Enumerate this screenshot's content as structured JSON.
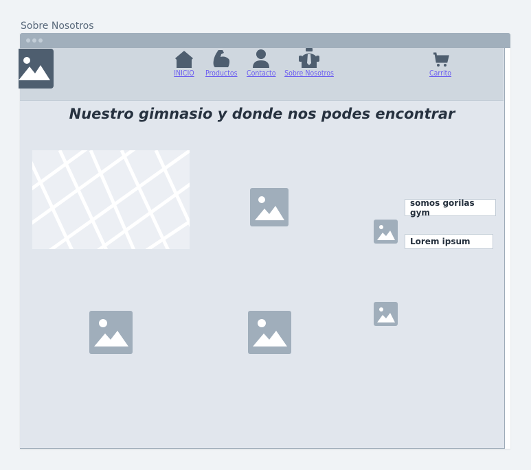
{
  "page": {
    "title": "Sobre Nosotros"
  },
  "nav": {
    "items": [
      {
        "label": "INICIO",
        "icon": "home-icon"
      },
      {
        "label": "Productos",
        "icon": "flexed-arm-icon"
      },
      {
        "label": "Contacto",
        "icon": "user-icon"
      },
      {
        "label": "Sobre Nosotros",
        "icon": "user-tie-icon"
      }
    ],
    "cart": {
      "label": "Carrito",
      "icon": "shopping-cart-icon"
    }
  },
  "main": {
    "headline": "Nuestro gimnasio y donde nos podes encontrar",
    "info": {
      "name_value": "somos gorilas gym",
      "description_value": "Lorem ipsum"
    }
  },
  "colors": {
    "link": "#6c5ef0",
    "placeholder": "#a0aebb",
    "header_bg": "#cfd7df",
    "content_bg": "#e1e6ed",
    "icon_dark": "#4e5e6f"
  }
}
